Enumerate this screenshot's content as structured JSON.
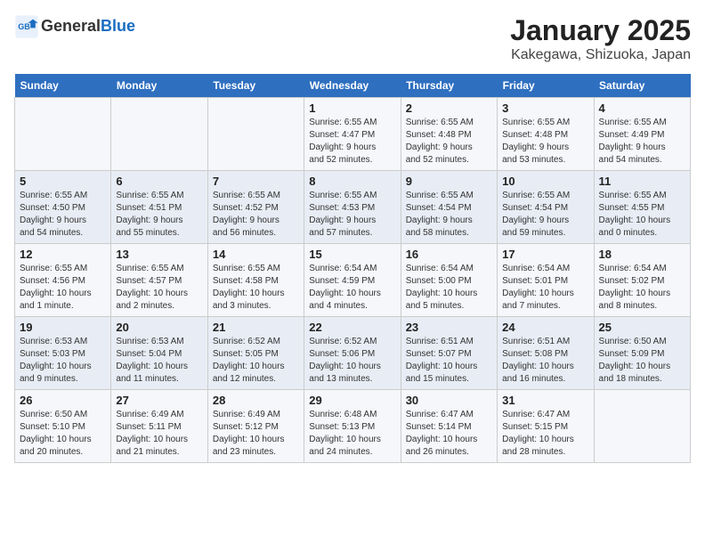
{
  "header": {
    "logo_line1": "General",
    "logo_line2": "Blue",
    "title": "January 2025",
    "subtitle": "Kakegawa, Shizuoka, Japan"
  },
  "weekdays": [
    "Sunday",
    "Monday",
    "Tuesday",
    "Wednesday",
    "Thursday",
    "Friday",
    "Saturday"
  ],
  "weeks": [
    [
      {
        "day": "",
        "detail": ""
      },
      {
        "day": "",
        "detail": ""
      },
      {
        "day": "",
        "detail": ""
      },
      {
        "day": "1",
        "detail": "Sunrise: 6:55 AM\nSunset: 4:47 PM\nDaylight: 9 hours\nand 52 minutes."
      },
      {
        "day": "2",
        "detail": "Sunrise: 6:55 AM\nSunset: 4:48 PM\nDaylight: 9 hours\nand 52 minutes."
      },
      {
        "day": "3",
        "detail": "Sunrise: 6:55 AM\nSunset: 4:48 PM\nDaylight: 9 hours\nand 53 minutes."
      },
      {
        "day": "4",
        "detail": "Sunrise: 6:55 AM\nSunset: 4:49 PM\nDaylight: 9 hours\nand 54 minutes."
      }
    ],
    [
      {
        "day": "5",
        "detail": "Sunrise: 6:55 AM\nSunset: 4:50 PM\nDaylight: 9 hours\nand 54 minutes."
      },
      {
        "day": "6",
        "detail": "Sunrise: 6:55 AM\nSunset: 4:51 PM\nDaylight: 9 hours\nand 55 minutes."
      },
      {
        "day": "7",
        "detail": "Sunrise: 6:55 AM\nSunset: 4:52 PM\nDaylight: 9 hours\nand 56 minutes."
      },
      {
        "day": "8",
        "detail": "Sunrise: 6:55 AM\nSunset: 4:53 PM\nDaylight: 9 hours\nand 57 minutes."
      },
      {
        "day": "9",
        "detail": "Sunrise: 6:55 AM\nSunset: 4:54 PM\nDaylight: 9 hours\nand 58 minutes."
      },
      {
        "day": "10",
        "detail": "Sunrise: 6:55 AM\nSunset: 4:54 PM\nDaylight: 9 hours\nand 59 minutes."
      },
      {
        "day": "11",
        "detail": "Sunrise: 6:55 AM\nSunset: 4:55 PM\nDaylight: 10 hours\nand 0 minutes."
      }
    ],
    [
      {
        "day": "12",
        "detail": "Sunrise: 6:55 AM\nSunset: 4:56 PM\nDaylight: 10 hours\nand 1 minute."
      },
      {
        "day": "13",
        "detail": "Sunrise: 6:55 AM\nSunset: 4:57 PM\nDaylight: 10 hours\nand 2 minutes."
      },
      {
        "day": "14",
        "detail": "Sunrise: 6:55 AM\nSunset: 4:58 PM\nDaylight: 10 hours\nand 3 minutes."
      },
      {
        "day": "15",
        "detail": "Sunrise: 6:54 AM\nSunset: 4:59 PM\nDaylight: 10 hours\nand 4 minutes."
      },
      {
        "day": "16",
        "detail": "Sunrise: 6:54 AM\nSunset: 5:00 PM\nDaylight: 10 hours\nand 5 minutes."
      },
      {
        "day": "17",
        "detail": "Sunrise: 6:54 AM\nSunset: 5:01 PM\nDaylight: 10 hours\nand 7 minutes."
      },
      {
        "day": "18",
        "detail": "Sunrise: 6:54 AM\nSunset: 5:02 PM\nDaylight: 10 hours\nand 8 minutes."
      }
    ],
    [
      {
        "day": "19",
        "detail": "Sunrise: 6:53 AM\nSunset: 5:03 PM\nDaylight: 10 hours\nand 9 minutes."
      },
      {
        "day": "20",
        "detail": "Sunrise: 6:53 AM\nSunset: 5:04 PM\nDaylight: 10 hours\nand 11 minutes."
      },
      {
        "day": "21",
        "detail": "Sunrise: 6:52 AM\nSunset: 5:05 PM\nDaylight: 10 hours\nand 12 minutes."
      },
      {
        "day": "22",
        "detail": "Sunrise: 6:52 AM\nSunset: 5:06 PM\nDaylight: 10 hours\nand 13 minutes."
      },
      {
        "day": "23",
        "detail": "Sunrise: 6:51 AM\nSunset: 5:07 PM\nDaylight: 10 hours\nand 15 minutes."
      },
      {
        "day": "24",
        "detail": "Sunrise: 6:51 AM\nSunset: 5:08 PM\nDaylight: 10 hours\nand 16 minutes."
      },
      {
        "day": "25",
        "detail": "Sunrise: 6:50 AM\nSunset: 5:09 PM\nDaylight: 10 hours\nand 18 minutes."
      }
    ],
    [
      {
        "day": "26",
        "detail": "Sunrise: 6:50 AM\nSunset: 5:10 PM\nDaylight: 10 hours\nand 20 minutes."
      },
      {
        "day": "27",
        "detail": "Sunrise: 6:49 AM\nSunset: 5:11 PM\nDaylight: 10 hours\nand 21 minutes."
      },
      {
        "day": "28",
        "detail": "Sunrise: 6:49 AM\nSunset: 5:12 PM\nDaylight: 10 hours\nand 23 minutes."
      },
      {
        "day": "29",
        "detail": "Sunrise: 6:48 AM\nSunset: 5:13 PM\nDaylight: 10 hours\nand 24 minutes."
      },
      {
        "day": "30",
        "detail": "Sunrise: 6:47 AM\nSunset: 5:14 PM\nDaylight: 10 hours\nand 26 minutes."
      },
      {
        "day": "31",
        "detail": "Sunrise: 6:47 AM\nSunset: 5:15 PM\nDaylight: 10 hours\nand 28 minutes."
      },
      {
        "day": "",
        "detail": ""
      }
    ]
  ]
}
